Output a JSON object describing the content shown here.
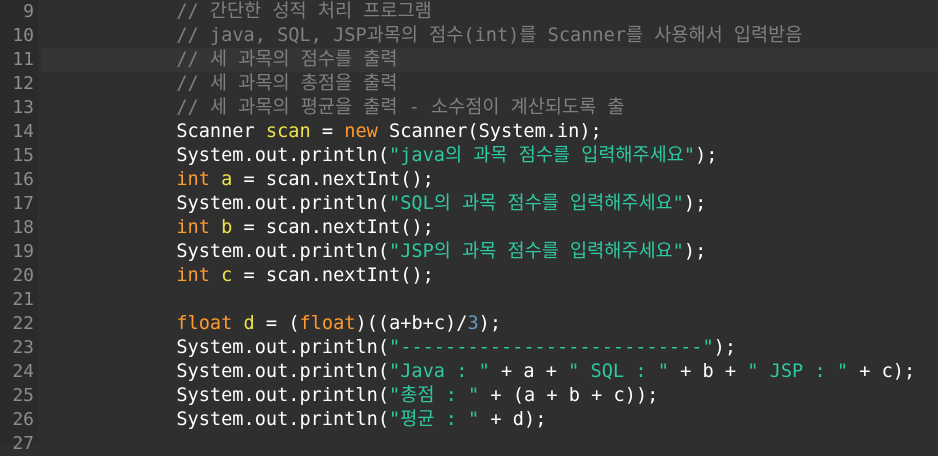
{
  "editor": {
    "colors": {
      "background": "#2f2f2f",
      "gutter": "#2b2b2b",
      "line_number": "#8c8c8c",
      "current_line": "#353535",
      "default_text": "#ffffff",
      "keyword": "#ff9a2e",
      "string": "#2ec9a0",
      "comment": "#7f7f7f",
      "declared_variable": "#f0e24a",
      "number": "#6897bb"
    },
    "current_line_number": "11",
    "lines": [
      {
        "number": "9",
        "tokens": [
          {
            "t": "            "
          },
          {
            "t": "// 간단한 성적 처리 프로그램",
            "c": "cm"
          }
        ]
      },
      {
        "number": "10",
        "tokens": [
          {
            "t": "            "
          },
          {
            "t": "// java, SQL, JSP과목의 점수(int)를 Scanner를 사용해서 입력받음",
            "c": "cm"
          }
        ]
      },
      {
        "number": "11",
        "tokens": [
          {
            "t": "            "
          },
          {
            "t": "// 세 과목의 점수를 출력",
            "c": "cm"
          }
        ]
      },
      {
        "number": "12",
        "tokens": [
          {
            "t": "            "
          },
          {
            "t": "// 세 과목의 총점을 출력",
            "c": "cm"
          }
        ]
      },
      {
        "number": "13",
        "tokens": [
          {
            "t": "            "
          },
          {
            "t": "// 세 과목의 평균을 출력 - 소수점이 계산되도록 출",
            "c": "cm"
          }
        ]
      },
      {
        "number": "14",
        "tokens": [
          {
            "t": "            Scanner "
          },
          {
            "t": "scan",
            "c": "var-decl"
          },
          {
            "t": " = "
          },
          {
            "t": "new",
            "c": "kw-blue"
          },
          {
            "t": " Scanner(System.in);"
          }
        ]
      },
      {
        "number": "15",
        "tokens": [
          {
            "t": "            System.out.println("
          },
          {
            "t": "\"java의 과목 점수를 입력해주세요\"",
            "c": "str"
          },
          {
            "t": ");"
          }
        ]
      },
      {
        "number": "16",
        "tokens": [
          {
            "t": "            "
          },
          {
            "t": "int",
            "c": "kw-blue"
          },
          {
            "t": " "
          },
          {
            "t": "a",
            "c": "var-decl"
          },
          {
            "t": " = scan.nextInt();"
          }
        ]
      },
      {
        "number": "17",
        "tokens": [
          {
            "t": "            System.out.println("
          },
          {
            "t": "\"SQL의 과목 점수를 입력해주세요\"",
            "c": "str"
          },
          {
            "t": ");"
          }
        ]
      },
      {
        "number": "18",
        "tokens": [
          {
            "t": "            "
          },
          {
            "t": "int",
            "c": "kw-blue"
          },
          {
            "t": " "
          },
          {
            "t": "b",
            "c": "var-decl"
          },
          {
            "t": " = scan.nextInt();"
          }
        ]
      },
      {
        "number": "19",
        "tokens": [
          {
            "t": "            System.out.println("
          },
          {
            "t": "\"JSP의 과목 점수를 입력해주세요\"",
            "c": "str"
          },
          {
            "t": ");"
          }
        ]
      },
      {
        "number": "20",
        "tokens": [
          {
            "t": "            "
          },
          {
            "t": "int",
            "c": "kw-blue"
          },
          {
            "t": " "
          },
          {
            "t": "c",
            "c": "var-decl"
          },
          {
            "t": " = scan.nextInt();"
          }
        ]
      },
      {
        "number": "21",
        "tokens": [
          {
            "t": ""
          }
        ]
      },
      {
        "number": "22",
        "tokens": [
          {
            "t": "            "
          },
          {
            "t": "float",
            "c": "kw-blue"
          },
          {
            "t": " "
          },
          {
            "t": "d",
            "c": "var-decl"
          },
          {
            "t": " = ("
          },
          {
            "t": "float",
            "c": "kw-blue"
          },
          {
            "t": ")((a+b+c)/"
          },
          {
            "t": "3",
            "c": "num"
          },
          {
            "t": ");"
          }
        ]
      },
      {
        "number": "23",
        "tokens": [
          {
            "t": "            System.out.println("
          },
          {
            "t": "\"---------------------------\"",
            "c": "str"
          },
          {
            "t": ");"
          }
        ]
      },
      {
        "number": "24",
        "tokens": [
          {
            "t": "            System.out.println("
          },
          {
            "t": "\"Java : \"",
            "c": "str"
          },
          {
            "t": " + a + "
          },
          {
            "t": "\" SQL : \"",
            "c": "str"
          },
          {
            "t": " + b + "
          },
          {
            "t": "\" JSP : \"",
            "c": "str"
          },
          {
            "t": " + c);"
          }
        ]
      },
      {
        "number": "25",
        "tokens": [
          {
            "t": "            System.out.println("
          },
          {
            "t": "\"총점 : \"",
            "c": "str"
          },
          {
            "t": " + (a + b + c));"
          }
        ]
      },
      {
        "number": "26",
        "tokens": [
          {
            "t": "            System.out.println("
          },
          {
            "t": "\"평균 : \"",
            "c": "str"
          },
          {
            "t": " + d);"
          }
        ]
      },
      {
        "number": "27",
        "tokens": [
          {
            "t": ""
          }
        ]
      }
    ]
  }
}
